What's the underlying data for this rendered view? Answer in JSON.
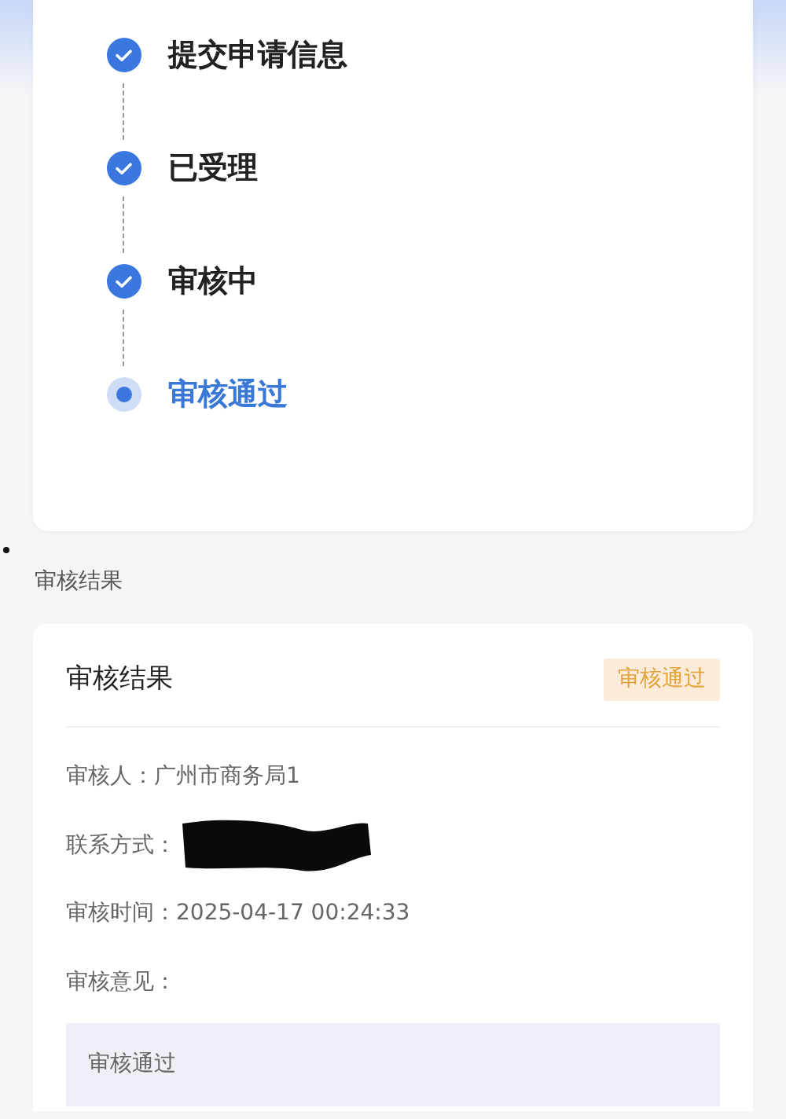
{
  "progress_steps": [
    {
      "label": "提交申请信息",
      "done": true
    },
    {
      "label": "已受理",
      "done": true
    },
    {
      "label": "审核中",
      "done": true
    },
    {
      "label": "审核通过",
      "done": false
    }
  ],
  "section_title": "审核结果",
  "result_card": {
    "title": "审核结果",
    "status_tag": "审核通过",
    "fields": [
      {
        "label": "审核人：",
        "value": "广州市商务局1",
        "redacted": false
      },
      {
        "label": "联系方式：",
        "redacted": true
      },
      {
        "label": "审核时间：",
        "value": "2025-04-17 00:24:33",
        "redacted": false
      },
      {
        "label": "审核意见：",
        "redacted": false
      }
    ],
    "opinion": "审核通过"
  }
}
